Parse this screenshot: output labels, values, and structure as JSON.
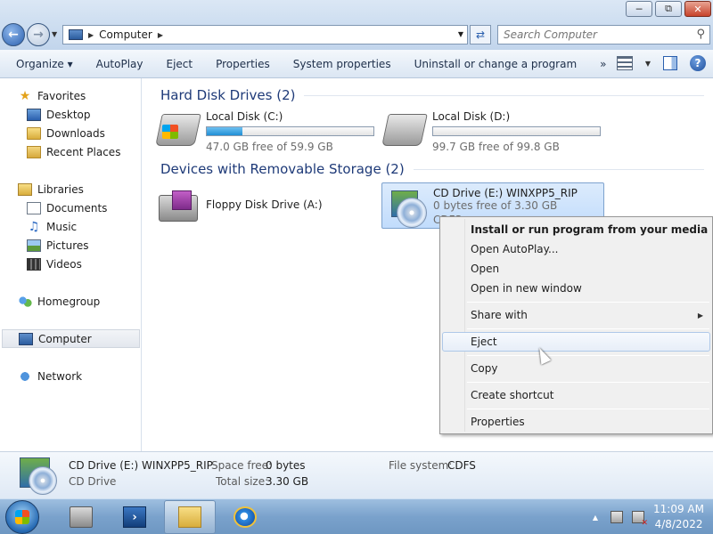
{
  "window": {
    "minimize_glyph": "─",
    "maximize_glyph": "⧉",
    "close_glyph": "✕"
  },
  "address": {
    "crumb": "Computer",
    "search_placeholder": "Search Computer"
  },
  "toolbar": {
    "items": [
      "Organize ▾",
      "AutoPlay",
      "Eject",
      "Properties",
      "System properties",
      "Uninstall or change a program",
      "»"
    ]
  },
  "nav": {
    "favorites": "Favorites",
    "desktop": "Desktop",
    "downloads": "Downloads",
    "recent_places": "Recent Places",
    "libraries": "Libraries",
    "documents": "Documents",
    "music": "Music",
    "pictures": "Pictures",
    "videos": "Videos",
    "homegroup": "Homegroup",
    "computer": "Computer",
    "network": "Network"
  },
  "groups": {
    "hard_disk": "Hard Disk Drives (2)",
    "removable": "Devices with Removable Storage (2)"
  },
  "drives": {
    "c": {
      "name": "Local Disk (C:)",
      "free": "47.0 GB free of 59.9 GB",
      "used_fraction": 0.215
    },
    "d": {
      "name": "Local Disk (D:)",
      "free": "99.7 GB free of 99.8 GB",
      "used_fraction": 0.001
    },
    "a": {
      "name": "Floppy Disk Drive (A:)"
    },
    "e": {
      "name": "CD Drive (E:) WINXPP5_RIP",
      "free": "0 bytes free of 3.30 GB",
      "fs": "CDFS"
    }
  },
  "context_menu": {
    "install": "Install or run program from your media",
    "autoplay": "Open AutoPlay...",
    "open": "Open",
    "open_new_window": "Open in new window",
    "share_with": "Share with",
    "eject": "Eject",
    "copy": "Copy",
    "create_shortcut": "Create shortcut",
    "properties": "Properties"
  },
  "details": {
    "name": "CD Drive (E:) WINXPP5_RIP",
    "type": "CD Drive",
    "space_free_label": "Space free:",
    "space_free": "0 bytes",
    "total_size_label": "Total size:",
    "total_size": "3.30 GB",
    "fs_label": "File system:",
    "fs": "CDFS"
  },
  "taskbar": {
    "time": "11:09 AM",
    "date": "4/8/2022"
  }
}
